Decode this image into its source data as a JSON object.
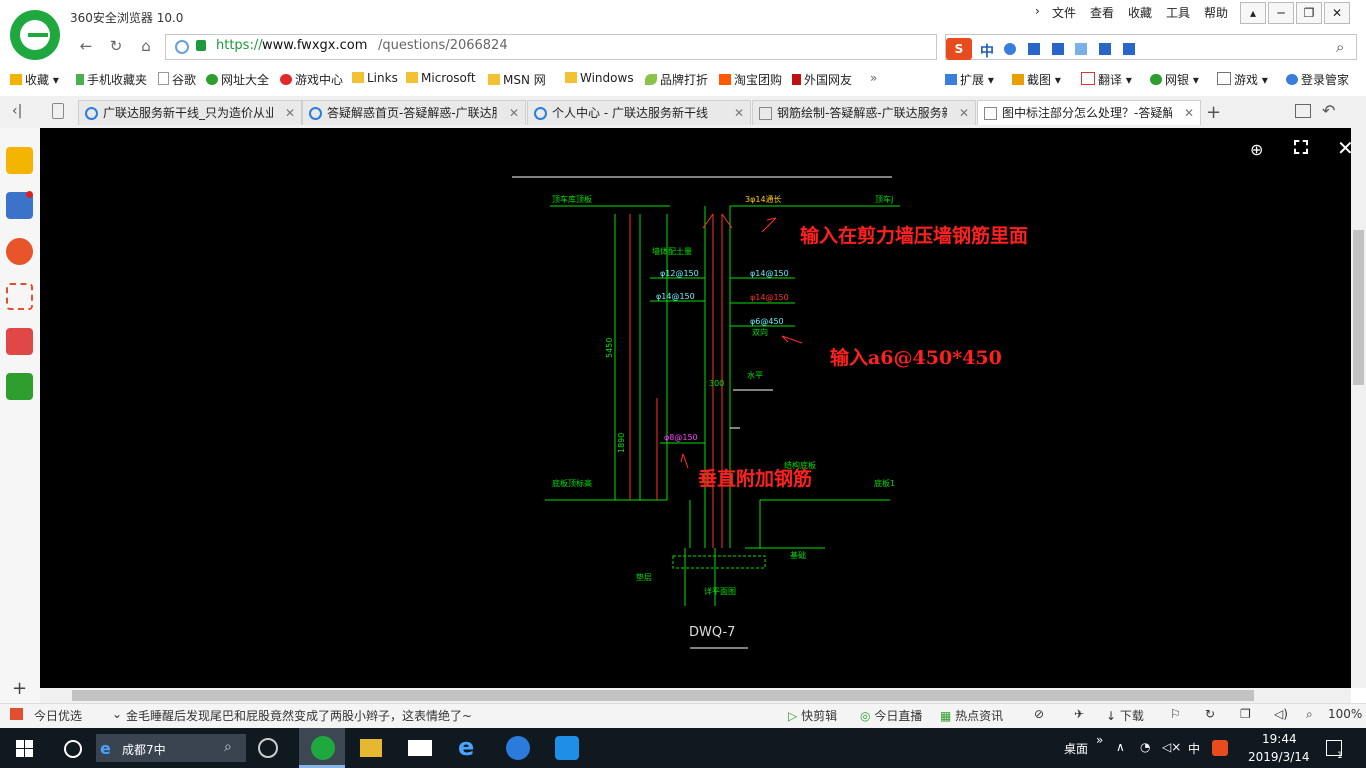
{
  "app": {
    "title": "360安全浏览器 10.0"
  },
  "menu": [
    "文件",
    "查看",
    "收藏",
    "工具",
    "帮助"
  ],
  "address": {
    "https": "https://",
    "domain": "www.fwxgx.com",
    "path": "/questions/2066824"
  },
  "search_ime": "中",
  "bookmarks": [
    {
      "label": "收藏",
      "color": "#f0b400"
    },
    {
      "label": "手机收藏夹",
      "color": "#4caf50"
    },
    {
      "label": "谷歌",
      "color": "#999999"
    },
    {
      "label": "网址大全",
      "color": "#2e9e2e"
    },
    {
      "label": "游戏中心",
      "color": "#e02a2a"
    },
    {
      "label": "Links",
      "color": "#f2c233"
    },
    {
      "label": "Microsoft",
      "color": "#f2c233"
    },
    {
      "label": "MSN 网",
      "color": "#f2c233"
    },
    {
      "label": "Windows",
      "color": "#f2c233"
    },
    {
      "label": "品牌打折",
      "color": "#8bc34a"
    },
    {
      "label": "淘宝团购",
      "color": "#ff5a00"
    },
    {
      "label": "外国网友",
      "color": "#c01010"
    }
  ],
  "toolbar_right": [
    "扩展",
    "截图",
    "翻译",
    "网银",
    "游戏",
    "登录管家"
  ],
  "tabs": [
    {
      "label": "广联达服务新干线_只为造价从业"
    },
    {
      "label": "答疑解惑首页-答疑解惑-广联达服"
    },
    {
      "label": "个人中心 - 广联达服务新干线"
    },
    {
      "label": "钢筋绘制-答疑解惑-广联达服务新"
    },
    {
      "label": "图中标注部分怎么处理？-答疑解"
    }
  ],
  "drawing": {
    "title": "DWQ-7",
    "labels": {
      "top_left": "顶车库顶板",
      "top_right": "顶车J",
      "rebar_top": "3φ14通长",
      "wall_note": "墙体配土量",
      "r1": "φ12@150",
      "r2": "φ14@150",
      "r3": "φ14@150",
      "r4": "φ14@150",
      "r5": "φ6@450",
      "r5b": "双向",
      "dim1": "5450",
      "dim2": "1890",
      "dim3": "300",
      "mid_note": "水平",
      "lower_rebar": "φ8@150",
      "bottom_left": "底板顶标高",
      "bottom_right": "底板1",
      "slab": "结构底板",
      "foundation": "基础",
      "cushion": "垫层",
      "section": "详平面图"
    },
    "annotations": {
      "note1": "输入在剪力墙压墙钢筋里面",
      "note2": "输入a6@450*450",
      "note3": "垂直附加钢筋"
    }
  },
  "status": {
    "left": "今日优选",
    "headline": "金毛睡醒后发现尾巴和屁股竟然变成了两股小辫子，这表情绝了~",
    "items": [
      "快剪辑",
      "今日直播",
      "热点资讯",
      "下载"
    ],
    "zoom": "100%"
  },
  "taskbar": {
    "search": "成都7中",
    "desktop": "桌面",
    "ime": "中",
    "time": "19:44",
    "date": "2019/3/14",
    "notif": "1"
  },
  "colors": {
    "accent": "#1fa83e",
    "cad_green": "#00e000",
    "cad_red": "#ff2020",
    "cad_bg": "#000000"
  }
}
